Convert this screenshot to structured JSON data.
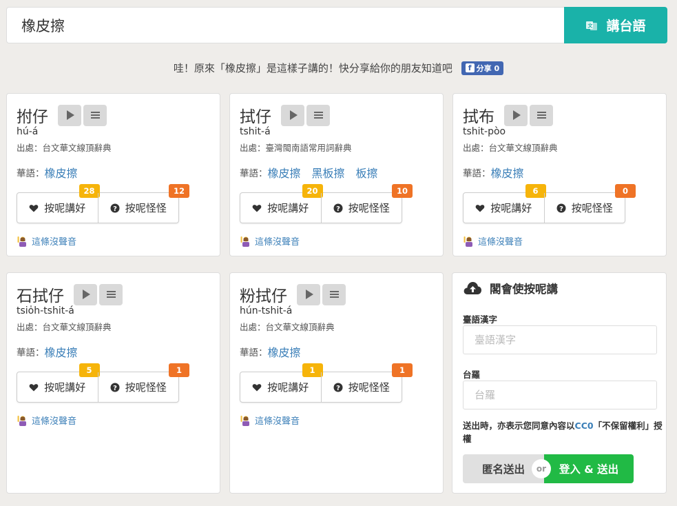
{
  "search": {
    "value": "橡皮擦",
    "button_label": "講台語"
  },
  "share": {
    "message": "哇！原來「橡皮擦」是這樣子講的！快分享給你的朋友知道吧",
    "fb_label": "分享 0"
  },
  "cards": [
    {
      "title": "拊仔",
      "roman": "hú-á",
      "source": "出處：台文華文線頂辭典",
      "mandarin_label": "華語：",
      "mandarin_words": [
        "橡皮擦"
      ],
      "like_label": "按呢講好",
      "like_count": "28",
      "dislike_label": "按呢怪怪",
      "dislike_count": "12",
      "no_audio": "這條沒聲音"
    },
    {
      "title": "拭仔",
      "roman": "tshit-á",
      "source": "出處：臺灣閩南語常用詞辭典",
      "mandarin_label": "華語：",
      "mandarin_words": [
        "橡皮擦",
        "黑板擦",
        "板擦"
      ],
      "like_label": "按呢講好",
      "like_count": "20",
      "dislike_label": "按呢怪怪",
      "dislike_count": "10",
      "no_audio": "這條沒聲音"
    },
    {
      "title": "拭布",
      "roman": "tshit-pòo",
      "source": "出處：台文華文線頂辭典",
      "mandarin_label": "華語：",
      "mandarin_words": [
        "橡皮擦"
      ],
      "like_label": "按呢講好",
      "like_count": "6",
      "dislike_label": "按呢怪怪",
      "dislike_count": "0",
      "no_audio": "這條沒聲音"
    },
    {
      "title": "石拭仔",
      "roman": "tsio̍h-tshit-á",
      "source": "出處：台文華文線頂辭典",
      "mandarin_label": "華語：",
      "mandarin_words": [
        "橡皮擦"
      ],
      "like_label": "按呢講好",
      "like_count": "5",
      "dislike_label": "按呢怪怪",
      "dislike_count": "1",
      "no_audio": "這條沒聲音"
    },
    {
      "title": "粉拭仔",
      "roman": "hún-tshit-á",
      "source": "出處：台文華文線頂辭典",
      "mandarin_label": "華語：",
      "mandarin_words": [
        "橡皮擦"
      ],
      "like_label": "按呢講好",
      "like_count": "1",
      "dislike_label": "按呢怪怪",
      "dislike_count": "1",
      "no_audio": "這條沒聲音"
    }
  ],
  "form": {
    "title": "閣會使按呢講",
    "hanji_label": "臺語漢字",
    "hanji_placeholder": "臺語漢字",
    "lomaji_label": "台羅",
    "lomaji_placeholder": "台羅",
    "license_prefix": "送出時，亦表示您同意內容以",
    "license_link": "CC0",
    "license_suffix": "「不保留權利」授權",
    "anon_button": "匿名送出",
    "or_label": "or",
    "login_button": "登入 & 送出"
  },
  "colors": {
    "accent_teal": "#1ab2a9",
    "link_blue": "#3b7fb8",
    "badge_yellow": "#f6b40a",
    "badge_orange": "#ef7326",
    "submit_green": "#21ba45",
    "fb_blue": "#4267b2"
  },
  "icons": {
    "search_button": "translate-icon",
    "play": "play-icon",
    "list": "list-icon",
    "like": "heart-icon",
    "dislike": "question-circle-icon",
    "no_audio": "person-raising-hand-icon",
    "form": "cloud-upload-icon"
  }
}
